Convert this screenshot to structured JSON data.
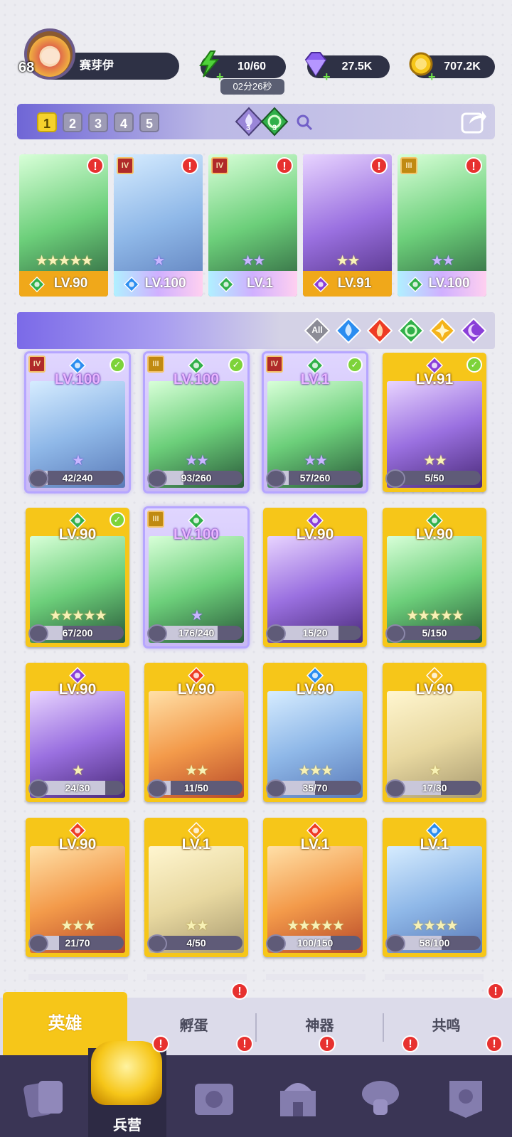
{
  "player": {
    "level": "68",
    "name": "赛芽伊"
  },
  "resources": {
    "energy": "10/60",
    "energy_timer": "02分26秒",
    "gems": "27.5K",
    "coins": "707.2K"
  },
  "teams": {
    "tabs": [
      "1",
      "2",
      "3",
      "4",
      "5"
    ],
    "active": 0,
    "water_count": "3",
    "nature_count": "3"
  },
  "team_slots": [
    {
      "level": "LV.90",
      "stars": "★★★★★",
      "star_style": "gold",
      "rank": "",
      "element": "nature"
    },
    {
      "level": "LV.100",
      "stars": "★",
      "star_style": "purple",
      "rank": "IV",
      "element": "water"
    },
    {
      "level": "LV.1",
      "stars": "★★",
      "star_style": "purple",
      "rank": "IV",
      "element": "nature"
    },
    {
      "level": "LV.91",
      "stars": "★★",
      "star_style": "gold",
      "rank": "",
      "element": "dark"
    },
    {
      "level": "LV.100",
      "stars": "★★",
      "star_style": "purple",
      "rank": "III",
      "element": "nature"
    }
  ],
  "filters": {
    "all_label": "All",
    "elements": [
      "water",
      "fire",
      "nature",
      "light",
      "dark"
    ]
  },
  "heroes": [
    {
      "level": "LV.100",
      "shards": "42/240",
      "fill": 0.175,
      "element": "water",
      "rank": "IV",
      "team": true,
      "check": true,
      "stars": "★",
      "star_style": "purple"
    },
    {
      "level": "LV.100",
      "shards": "93/260",
      "fill": 0.358,
      "element": "nature",
      "rank": "III",
      "team": true,
      "check": true,
      "stars": "★★",
      "star_style": "purple"
    },
    {
      "level": "LV.1",
      "shards": "57/260",
      "fill": 0.219,
      "element": "nature",
      "rank": "IV",
      "team": true,
      "check": true,
      "stars": "★★",
      "star_style": "purple"
    },
    {
      "level": "LV.91",
      "shards": "5/50",
      "fill": 0.1,
      "element": "dark",
      "rank": "",
      "team": false,
      "check": true,
      "stars": "★★",
      "star_style": "gold"
    },
    {
      "level": "LV.90",
      "shards": "67/200",
      "fill": 0.335,
      "element": "nature",
      "rank": "",
      "team": false,
      "check": true,
      "stars": "★★★★★",
      "star_style": "gold"
    },
    {
      "level": "LV.100",
      "shards": "176/240",
      "fill": 0.733,
      "element": "nature",
      "rank": "III",
      "team": true,
      "check": false,
      "stars": "★",
      "star_style": "purple"
    },
    {
      "level": "LV.90",
      "shards": "15/20",
      "fill": 0.75,
      "element": "dark",
      "rank": "",
      "team": false,
      "check": false,
      "stars": "",
      "star_style": "gold"
    },
    {
      "level": "LV.90",
      "shards": "5/150",
      "fill": 0.033,
      "element": "nature",
      "rank": "",
      "team": false,
      "check": false,
      "stars": "★★★★★",
      "star_style": "gold"
    },
    {
      "level": "LV.90",
      "shards": "24/30",
      "fill": 0.8,
      "element": "dark",
      "rank": "",
      "team": false,
      "check": false,
      "stars": "★",
      "star_style": "gold"
    },
    {
      "level": "LV.90",
      "shards": "11/50",
      "fill": 0.22,
      "element": "fire",
      "rank": "",
      "team": false,
      "check": false,
      "stars": "★★",
      "star_style": "gold"
    },
    {
      "level": "LV.90",
      "shards": "35/70",
      "fill": 0.5,
      "element": "water",
      "rank": "",
      "team": false,
      "check": false,
      "stars": "★★★",
      "star_style": "gold"
    },
    {
      "level": "LV.90",
      "shards": "17/30",
      "fill": 0.567,
      "element": "light",
      "rank": "",
      "team": false,
      "check": false,
      "stars": "★",
      "star_style": "gold"
    },
    {
      "level": "LV.90",
      "shards": "21/70",
      "fill": 0.3,
      "element": "fire",
      "rank": "",
      "team": false,
      "check": false,
      "stars": "★★★",
      "star_style": "gold"
    },
    {
      "level": "LV.1",
      "shards": "4/50",
      "fill": 0.08,
      "element": "light",
      "rank": "",
      "team": false,
      "check": false,
      "stars": "★★",
      "star_style": "gold"
    },
    {
      "level": "LV.1",
      "shards": "100/150",
      "fill": 0.667,
      "element": "fire",
      "rank": "",
      "team": false,
      "check": false,
      "stars": "★★★★★",
      "star_style": "gold"
    },
    {
      "level": "LV.1",
      "shards": "58/100",
      "fill": 0.58,
      "element": "water",
      "rank": "",
      "team": false,
      "check": false,
      "stars": "★★★★",
      "star_style": "gold"
    }
  ],
  "sub_tabs": [
    "英雄",
    "孵蛋",
    "神器",
    "共鸣"
  ],
  "nav": {
    "active_label": "兵营"
  },
  "colors": {
    "water": "#2b8df0",
    "fire": "#ee3b24",
    "nature": "#31b04a",
    "light": "#f4b31a",
    "dark": "#8a3fd8",
    "gold": "#f6c619",
    "navbar": "#3a3555"
  }
}
